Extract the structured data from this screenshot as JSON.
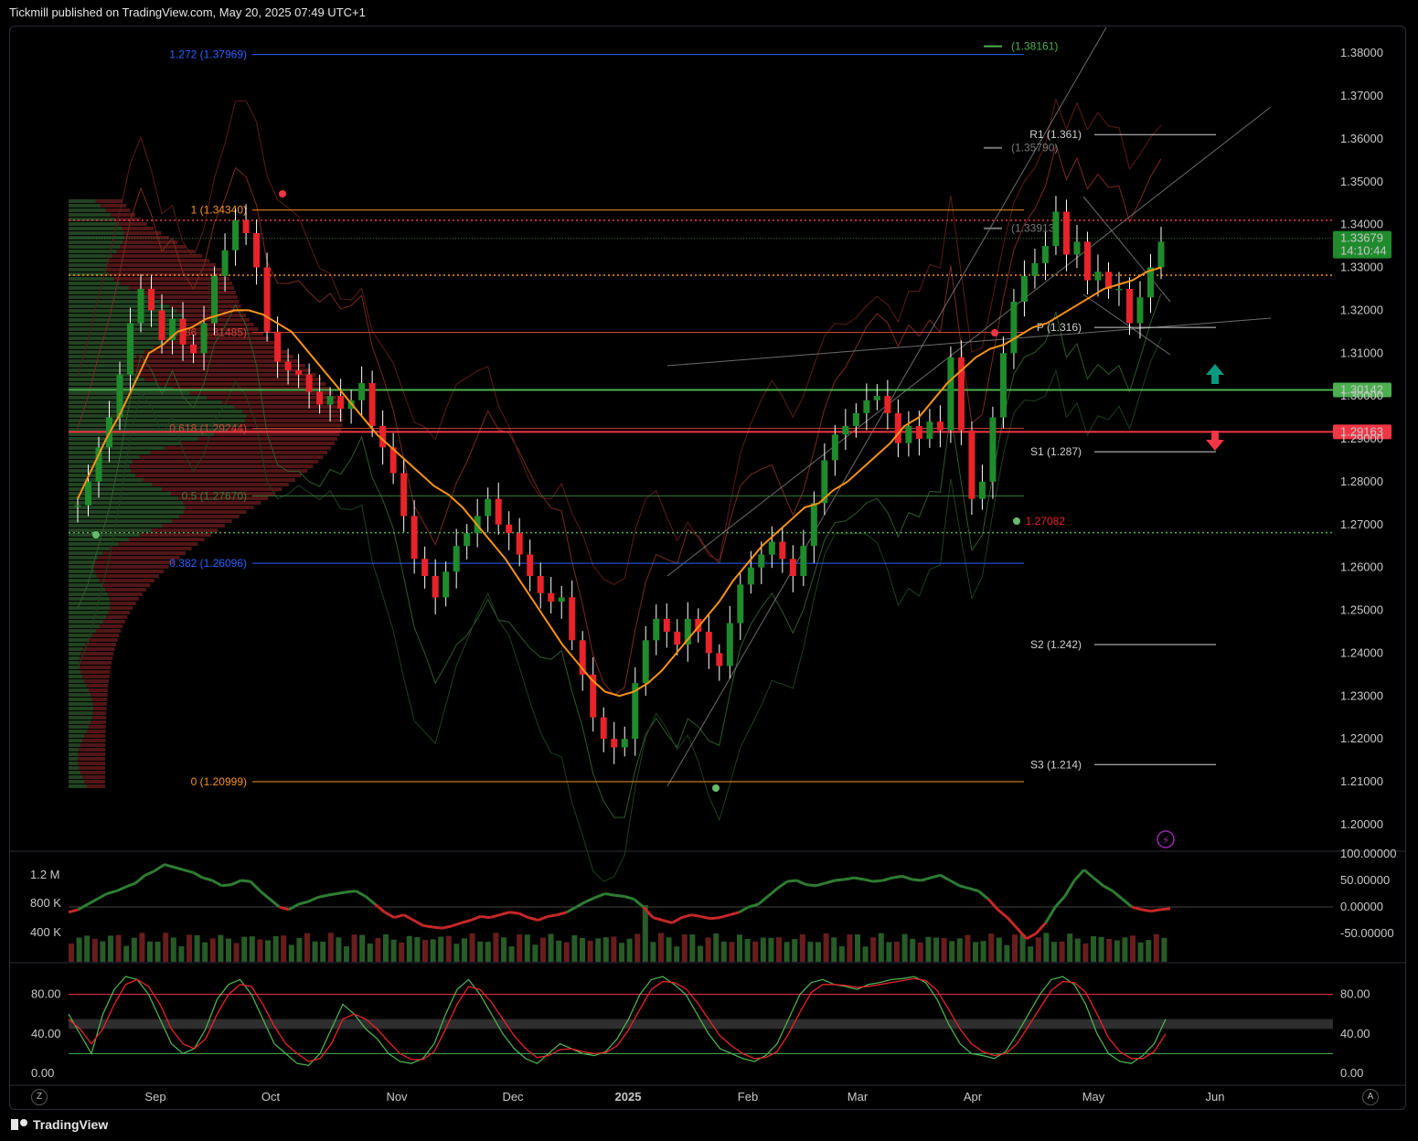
{
  "header": {
    "text": "Tickmill published on TradingView.com, May 20, 2025 07:49 UTC+1"
  },
  "footer": {
    "brand": "TradingView"
  },
  "buttons": {
    "zoom": "Z",
    "auto": "A"
  },
  "colors": {
    "bull": "#26a69a",
    "candle_up": "#1f8b2c",
    "candle_down": "#e8232a",
    "ema": "#f7931a",
    "support": "#4caf50",
    "resistance": "#f23645",
    "fib_blue": "#2962ff",
    "fib_orange": "#f7931a",
    "arrow_up": "#089981",
    "arrow_down": "#f23645"
  },
  "chart_data": [
    {
      "type": "candlestick",
      "panel": "price",
      "y_axis_ticks": [
        "1.38000",
        "1.37000",
        "1.36000",
        "1.35000",
        "1.34000",
        "1.33000",
        "1.32000",
        "1.31000",
        "1.30000",
        "1.29000",
        "1.28000",
        "1.27000",
        "1.26000",
        "1.25000",
        "1.24000",
        "1.23000",
        "1.22000",
        "1.21000",
        "1.20000"
      ],
      "ylim": [
        1.194,
        1.386
      ],
      "x_axis_ticks": [
        "Sep",
        "Oct",
        "Nov",
        "Dec",
        "2025",
        "Feb",
        "Mar",
        "Apr",
        "May",
        "Jun"
      ],
      "current_price": {
        "value": "1.33679",
        "countdown": "14:10:44"
      },
      "price_labels": [
        {
          "label": "1.30142",
          "value": 1.30142,
          "kind": "support"
        },
        {
          "label": "1.29163",
          "value": 1.29163,
          "kind": "resistance"
        }
      ],
      "fib_levels": [
        {
          "label": "1.272 (1.37969)",
          "value": 1.37969,
          "color": "blue"
        },
        {
          "label": "1 (1.34340)",
          "value": 1.3434,
          "color": "orange"
        },
        {
          "label": "0.786 (1.31485)",
          "value": 1.31485,
          "color": "red"
        },
        {
          "label": "0.618 (1.29244)",
          "value": 1.29244,
          "color": "red"
        },
        {
          "label": "0.5 (1.27670)",
          "value": 1.2767,
          "color": "green"
        },
        {
          "label": "0.382 (1.26096)",
          "value": 1.26096,
          "color": "blue"
        },
        {
          "label": "0 (1.20999)",
          "value": 1.20999,
          "color": "orange"
        }
      ],
      "pivots": [
        {
          "label": "R1 (1.361)",
          "value": 1.361
        },
        {
          "label": "P (1.316)",
          "value": 1.316
        },
        {
          "label": "S1 (1.287)",
          "value": 1.287
        },
        {
          "label": "S2 (1.242)",
          "value": 1.242
        },
        {
          "label": "S3 (1.214)",
          "value": 1.214
        }
      ],
      "other_levels": [
        {
          "label": "(1.38161)",
          "value": 1.38161
        },
        {
          "label": "(1.35790)",
          "value": 1.3579
        },
        {
          "label": "(1.33913)",
          "value": 1.33913
        },
        {
          "label": "1.27082",
          "value": 1.27082
        }
      ],
      "horizontal_lines": [
        {
          "value": 1.341,
          "style": "dotted",
          "color": "red"
        },
        {
          "value": 1.3282,
          "style": "dotted",
          "color": "orange"
        },
        {
          "value": 1.2681,
          "style": "dotted",
          "color": "green"
        }
      ],
      "ohlc_path": [
        1.2745,
        1.28,
        1.288,
        1.295,
        1.305,
        1.317,
        1.325,
        1.32,
        1.313,
        1.318,
        1.312,
        1.31,
        1.317,
        1.328,
        1.334,
        1.341,
        1.338,
        1.33,
        1.315,
        1.308,
        1.306,
        1.305,
        1.301,
        1.298,
        1.3,
        1.297,
        1.299,
        1.303,
        1.293,
        1.288,
        1.282,
        1.272,
        1.262,
        1.258,
        1.253,
        1.259,
        1.265,
        1.268,
        1.272,
        1.276,
        1.27,
        1.268,
        1.263,
        1.258,
        1.254,
        1.252,
        1.253,
        1.243,
        1.235,
        1.225,
        1.22,
        1.218,
        1.22,
        1.233,
        1.243,
        1.248,
        1.245,
        1.242,
        1.248,
        1.245,
        1.24,
        1.237,
        1.247,
        1.256,
        1.26,
        1.263,
        1.266,
        1.262,
        1.258,
        1.265,
        1.275,
        1.285,
        1.291,
        1.293,
        1.296,
        1.299,
        1.3,
        1.296,
        1.289,
        1.293,
        1.29,
        1.294,
        1.292,
        1.309,
        1.292,
        1.276,
        1.28,
        1.295,
        1.31,
        1.322,
        1.328,
        1.331,
        1.335,
        1.343,
        1.333,
        1.336,
        1.327,
        1.329,
        1.325,
        1.325,
        1.317,
        1.323,
        1.33,
        1.336
      ],
      "ema_path": [
        1.276,
        1.283,
        1.29,
        1.296,
        1.303,
        1.31,
        1.312,
        1.315,
        1.316,
        1.318,
        1.319,
        1.32,
        1.32,
        1.319,
        1.317,
        1.315,
        1.311,
        1.307,
        1.303,
        1.299,
        1.295,
        1.291,
        1.288,
        1.285,
        1.282,
        1.279,
        1.277,
        1.274,
        1.27,
        1.266,
        1.262,
        1.257,
        1.252,
        1.247,
        1.242,
        1.238,
        1.234,
        1.231,
        1.23,
        1.231,
        1.233,
        1.236,
        1.24,
        1.244,
        1.248,
        1.252,
        1.257,
        1.261,
        1.265,
        1.268,
        1.271,
        1.274,
        1.275,
        1.278,
        1.28,
        1.283,
        1.286,
        1.289,
        1.293,
        1.295,
        1.299,
        1.303,
        1.306,
        1.309,
        1.311,
        1.312,
        1.314,
        1.316,
        1.317,
        1.319,
        1.321,
        1.323,
        1.325,
        1.326,
        1.327,
        1.329,
        1.33
      ]
    },
    {
      "type": "line",
      "panel": "momentum",
      "y_axis_ticks": [
        "100.00000",
        "50.00000",
        "0.00000",
        "-50.00000"
      ],
      "volume_ticks": [
        "1.2 M",
        "800 K",
        "400 K"
      ],
      "ylim": [
        -100,
        100
      ],
      "values": [
        -10,
        -5,
        5,
        15,
        25,
        30,
        38,
        45,
        60,
        68,
        80,
        75,
        70,
        65,
        55,
        50,
        40,
        42,
        50,
        48,
        30,
        15,
        0,
        -5,
        5,
        10,
        18,
        22,
        25,
        28,
        30,
        20,
        5,
        -10,
        -20,
        -15,
        -25,
        -35,
        -38,
        -40,
        -36,
        -30,
        -25,
        -18,
        -20,
        -15,
        -10,
        -12,
        -20,
        -25,
        -18,
        -15,
        -10,
        0,
        10,
        18,
        25,
        22,
        20,
        15,
        0,
        -20,
        -25,
        -30,
        -20,
        -15,
        -18,
        -22,
        -20,
        -15,
        -10,
        0,
        5,
        20,
        35,
        48,
        50,
        42,
        40,
        45,
        50,
        52,
        55,
        52,
        48,
        50,
        55,
        58,
        52,
        50,
        55,
        60,
        50,
        40,
        35,
        30,
        15,
        -5,
        -20,
        -40,
        -60,
        -50,
        -30,
        0,
        20,
        50,
        70,
        55,
        40,
        30,
        15,
        0,
        -5,
        -8,
        -5,
        -3
      ]
    },
    {
      "type": "line",
      "panel": "stochastic",
      "y_axis_ticks": [
        "80.00",
        "40.00",
        "0.00"
      ],
      "ylim": [
        0,
        100
      ],
      "series": [
        {
          "values": [
            60,
            40,
            20,
            60,
            85,
            98,
            95,
            80,
            55,
            30,
            20,
            25,
            45,
            75,
            90,
            95,
            80,
            55,
            30,
            20,
            10,
            8,
            20,
            45,
            70,
            60,
            45,
            35,
            20,
            12,
            10,
            15,
            30,
            60,
            85,
            95,
            80,
            60,
            40,
            25,
            15,
            10,
            20,
            30,
            25,
            20,
            18,
            22,
            35,
            55,
            80,
            95,
            98,
            90,
            80,
            60,
            40,
            25,
            20,
            15,
            12,
            18,
            30,
            55,
            80,
            92,
            95,
            90,
            88,
            85,
            90,
            92,
            95,
            96,
            98,
            92,
            75,
            50,
            30,
            20,
            18,
            15,
            22,
            40,
            60,
            80,
            95,
            98,
            90,
            70,
            40,
            20,
            12,
            10,
            18,
            30,
            55
          ]
        },
        {
          "values": [
            55,
            45,
            30,
            45,
            70,
            90,
            95,
            88,
            70,
            45,
            30,
            25,
            35,
            60,
            80,
            90,
            88,
            70,
            48,
            30,
            20,
            12,
            15,
            30,
            55,
            60,
            55,
            45,
            32,
            20,
            14,
            14,
            22,
            45,
            70,
            88,
            85,
            72,
            55,
            38,
            25,
            16,
            18,
            24,
            25,
            22,
            20,
            21,
            28,
            44,
            65,
            85,
            93,
            92,
            86,
            72,
            55,
            38,
            28,
            20,
            15,
            16,
            22,
            40,
            62,
            82,
            90,
            90,
            89,
            87,
            88,
            90,
            92,
            94,
            96,
            94,
            84,
            65,
            45,
            30,
            22,
            18,
            20,
            30,
            48,
            66,
            84,
            93,
            92,
            82,
            60,
            36,
            22,
            15,
            15,
            22,
            40
          ]
        }
      ]
    }
  ]
}
